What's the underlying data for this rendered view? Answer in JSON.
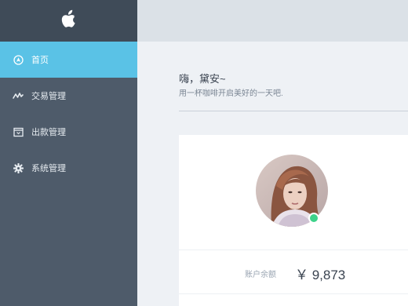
{
  "sidebar": {
    "logo_icon": "apple-icon",
    "items": [
      {
        "label": "首页",
        "icon": "home-icon",
        "active": true
      },
      {
        "label": "交易管理",
        "icon": "pulse-icon",
        "active": false
      },
      {
        "label": "出款管理",
        "icon": "window-icon",
        "active": false
      },
      {
        "label": "系统管理",
        "icon": "gear-icon",
        "active": false
      }
    ]
  },
  "main": {
    "greeting": "嗨，黛安~",
    "subtitle": "用一杯咖啡开启美好的一天吧."
  },
  "card": {
    "status": "online",
    "balance_label": "账户余额",
    "balance_value": "￥ 9,873"
  },
  "colors": {
    "sidebar": "#4e5b6a",
    "active": "#5ac2e6",
    "online": "#3dd28a"
  }
}
